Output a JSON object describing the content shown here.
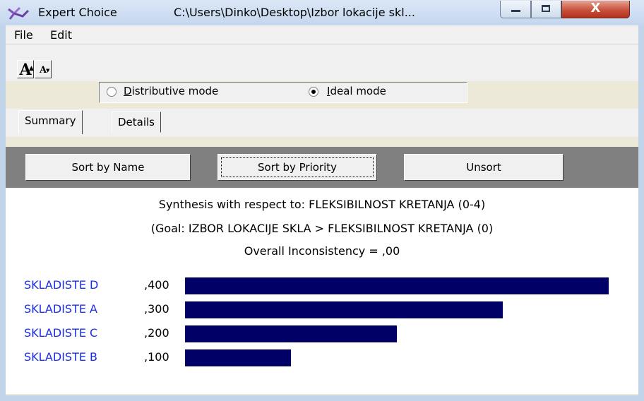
{
  "window": {
    "app_name": "Expert Choice",
    "file_path": "C:\\Users\\Dinko\\Desktop\\Izbor lokacije skl...",
    "close_glyph": "X"
  },
  "menu": [
    {
      "label": "File"
    },
    {
      "label": "Edit"
    }
  ],
  "toolbar": {
    "font_larger_glyph": "A",
    "font_smaller_glyph": "A",
    "modes": [
      {
        "label": "Distributive mode",
        "checked": false
      },
      {
        "label": "Ideal mode",
        "checked": true
      }
    ]
  },
  "tabs": [
    {
      "label": "Summary",
      "active": true
    },
    {
      "label": "Details",
      "active": false
    }
  ],
  "sort_buttons": [
    {
      "label": "Sort by Name",
      "focused": false
    },
    {
      "label": "Sort by Priority",
      "focused": true
    },
    {
      "label": "Unsort",
      "focused": false
    }
  ],
  "synthesis": {
    "line1": "Synthesis with respect to: FLEKSIBILNOST KRETANJA (0-4)",
    "line2": "(Goal: IZBOR LOKACIJE SKLA > FLEKSIBILNOST KRETANJA (0)",
    "line3": "Overall Inconsistency = ,00"
  },
  "chart_data": {
    "type": "bar",
    "categories": [
      "SKLADISTE D",
      "SKLADISTE A",
      "SKLADISTE C",
      "SKLADISTE B"
    ],
    "value_labels": [
      ",400",
      ",300",
      ",200",
      ",100"
    ],
    "values": [
      0.4,
      0.3,
      0.2,
      0.1
    ],
    "max_value": 0.4,
    "bar_color": "#000066",
    "label_color": "#1a2ee6"
  },
  "icons": {
    "app_icon": "expert-choice-logo-icon"
  }
}
